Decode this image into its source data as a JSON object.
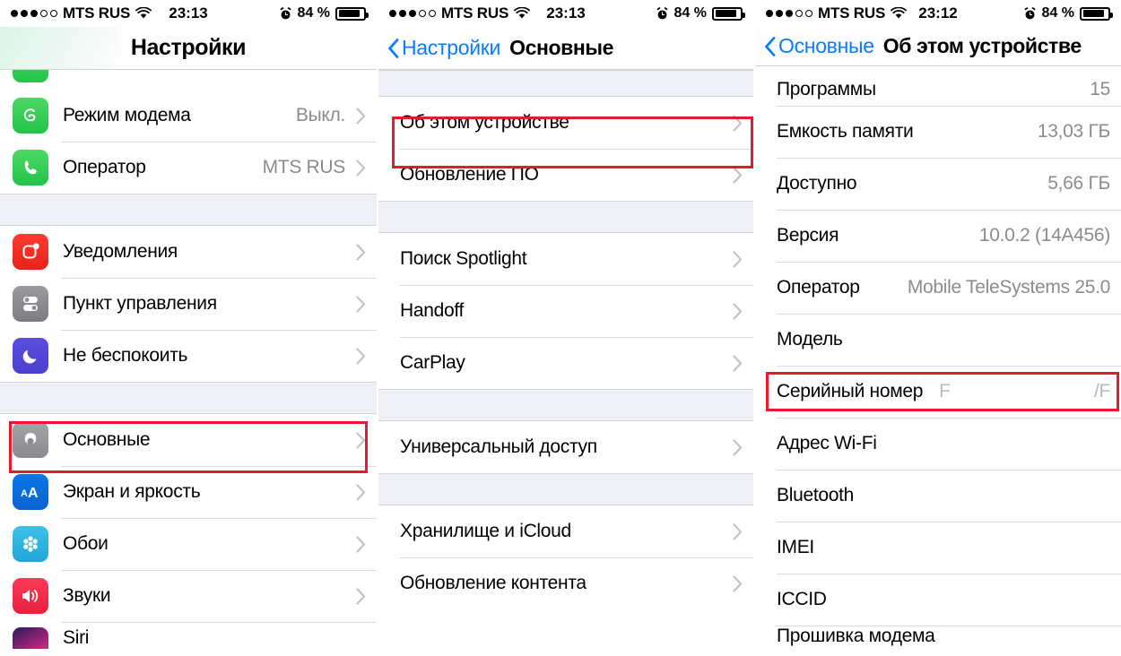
{
  "status_bars": {
    "settings": {
      "signal_filled": 3,
      "signal_hollow": 2,
      "carrier": "MTS RUS",
      "time": "23:13",
      "battery_pct": "84 %"
    },
    "general": {
      "signal_filled": 3,
      "signal_hollow": 2,
      "carrier": "MTS RUS",
      "time": "23:13",
      "battery_pct": "84 %"
    },
    "about": {
      "signal_filled": 3,
      "signal_hollow": 2,
      "carrier": "MTS RUS",
      "time": "23:12",
      "battery_pct": "84 %"
    }
  },
  "screen_settings": {
    "title": "Настройки",
    "rows": [
      {
        "label": "Режим модема",
        "value": "Выкл.",
        "icon": "hotspot-icon"
      },
      {
        "label": "Оператор",
        "value": "MTS RUS",
        "icon": "phone-icon"
      },
      {
        "label": "Уведомления",
        "value": "",
        "icon": "notifications-icon"
      },
      {
        "label": "Пункт управления",
        "value": "",
        "icon": "control-center-icon"
      },
      {
        "label": "Не беспокоить",
        "value": "",
        "icon": "do-not-disturb-icon"
      },
      {
        "label": "Основные",
        "value": "",
        "icon": "general-gear-icon"
      },
      {
        "label": "Экран и яркость",
        "value": "",
        "icon": "display-brightness-icon"
      },
      {
        "label": "Обои",
        "value": "",
        "icon": "wallpaper-icon"
      },
      {
        "label": "Звуки",
        "value": "",
        "icon": "sounds-icon"
      },
      {
        "label": "Siri",
        "value": "",
        "icon": "siri-icon"
      }
    ]
  },
  "screen_general": {
    "back_label": "Настройки",
    "title": "Основные",
    "rows": [
      {
        "label": "Об этом устройстве"
      },
      {
        "label": "Обновление ПО"
      },
      {
        "label": "Поиск Spotlight"
      },
      {
        "label": "Handoff"
      },
      {
        "label": "CarPlay"
      },
      {
        "label": "Универсальный доступ"
      },
      {
        "label": "Хранилище и iCloud"
      },
      {
        "label": "Обновление контента"
      }
    ]
  },
  "screen_about": {
    "back_label": "Основные",
    "title": "Об этом устройстве",
    "rows": [
      {
        "label": "Программы",
        "value": "15",
        "redacted": false
      },
      {
        "label": "Емкость памяти",
        "value": "13,03 ГБ",
        "redacted": false
      },
      {
        "label": "Доступно",
        "value": "5,66 ГБ",
        "redacted": false
      },
      {
        "label": "Версия",
        "value": "10.0.2 (14A456)",
        "redacted": false
      },
      {
        "label": "Оператор",
        "value": "Mobile TeleSystems 25.0",
        "redacted": false
      },
      {
        "label": "Модель",
        "value": "",
        "redacted": true
      },
      {
        "label": "Серийный номер",
        "value": "F",
        "value_right": "/F",
        "redacted": true
      },
      {
        "label": "Адрес Wi-Fi",
        "value": "",
        "redacted": true
      },
      {
        "label": "Bluetooth",
        "value": "",
        "redacted": true
      },
      {
        "label": "IMEI",
        "value": "",
        "redacted": true
      },
      {
        "label": "ICCID",
        "value": "",
        "redacted": true
      },
      {
        "label": "Прошивка модема",
        "value": "",
        "redacted": true
      }
    ]
  },
  "highlights": {
    "color": "#e8192c",
    "items": [
      {
        "name": "general-row-highlight",
        "screen": "settings"
      },
      {
        "name": "about-device-row-highlight",
        "screen": "general"
      },
      {
        "name": "serial-number-row-highlight",
        "screen": "about"
      }
    ]
  }
}
